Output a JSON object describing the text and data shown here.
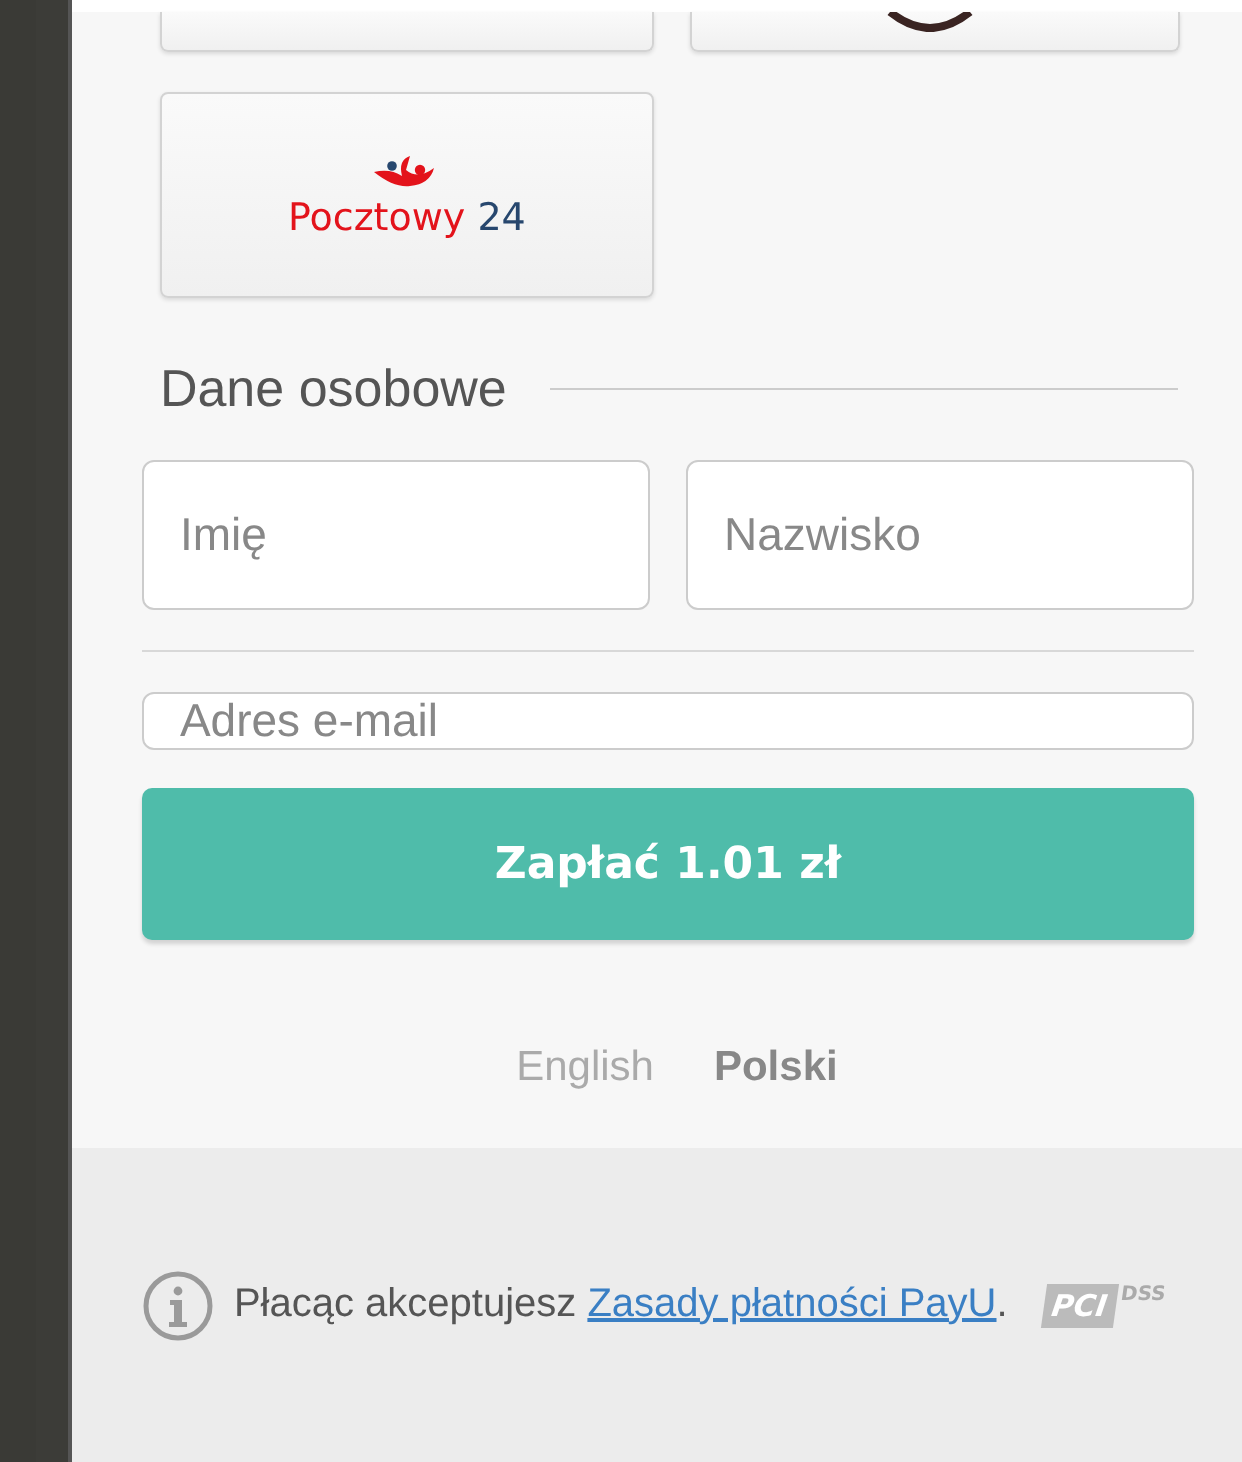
{
  "methods": [
    {
      "kind": "cut"
    },
    {
      "kind": "ring"
    },
    {
      "kind": "pocztowy",
      "name": "Pocztowy",
      "number": "24"
    }
  ],
  "section": {
    "title": "Dane osobowe"
  },
  "fields": [
    {
      "placeholder": "Imię"
    },
    {
      "placeholder": "Nazwisko"
    },
    {
      "placeholder": "Adres e-mail"
    }
  ],
  "pay_button": "Zapłać 1.01 zł",
  "languages": [
    {
      "label": "English",
      "selected": false
    },
    {
      "label": "Polski",
      "selected": true
    }
  ],
  "notice": {
    "text": "Płacąc akceptujesz",
    "link": "Zasady płatności PayU",
    "end": "."
  },
  "pci_logo": {
    "mark": "PCI",
    "sub": "DSS"
  }
}
